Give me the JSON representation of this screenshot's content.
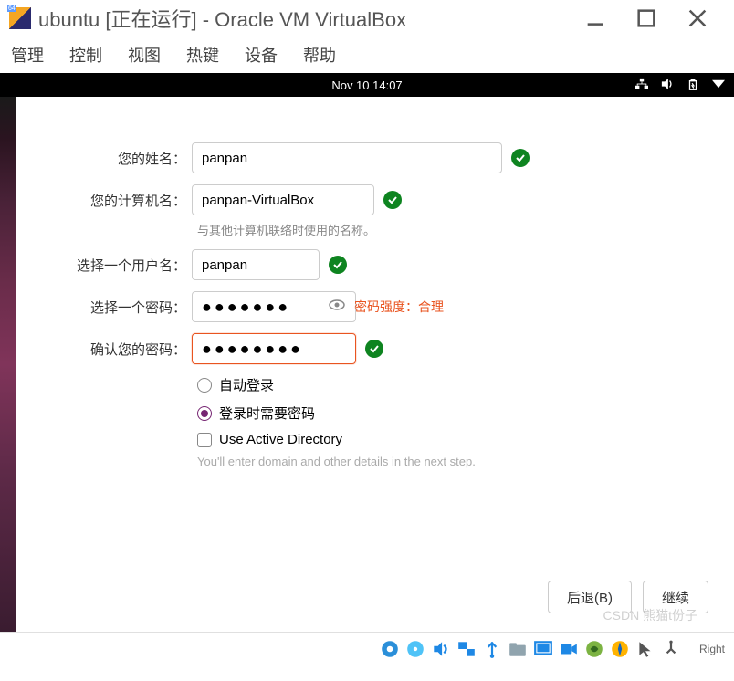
{
  "window": {
    "title": "ubuntu [正在运行] - Oracle VM VirtualBox"
  },
  "menu": {
    "items": [
      "管理",
      "控制",
      "视图",
      "热键",
      "设备",
      "帮助"
    ]
  },
  "vm_topbar": {
    "datetime": "Nov 10  14:07"
  },
  "form": {
    "name_label": "您的姓名：",
    "name_value": "panpan",
    "computer_label": "您的计算机名：",
    "computer_value": "panpan-VirtualBox",
    "computer_hint": "与其他计算机联络时使用的名称。",
    "username_label": "选择一个用户名：",
    "username_value": "panpan",
    "password_label": "选择一个密码：",
    "password_value": "●●●●●●●",
    "password_strength_label": "密码强度：合理",
    "confirm_label": "确认您的密码：",
    "confirm_value": "●●●●●●●●",
    "auto_login_label": "自动登录",
    "require_password_label": "登录时需要密码",
    "use_ad_label": "Use Active Directory",
    "ad_hint": "You'll enter domain and other details in the next step."
  },
  "buttons": {
    "back": "后退(B)",
    "continue": "继续"
  },
  "statusbar": {
    "host_key": "Right",
    "watermark": "CSDN 熊猫t份子"
  }
}
